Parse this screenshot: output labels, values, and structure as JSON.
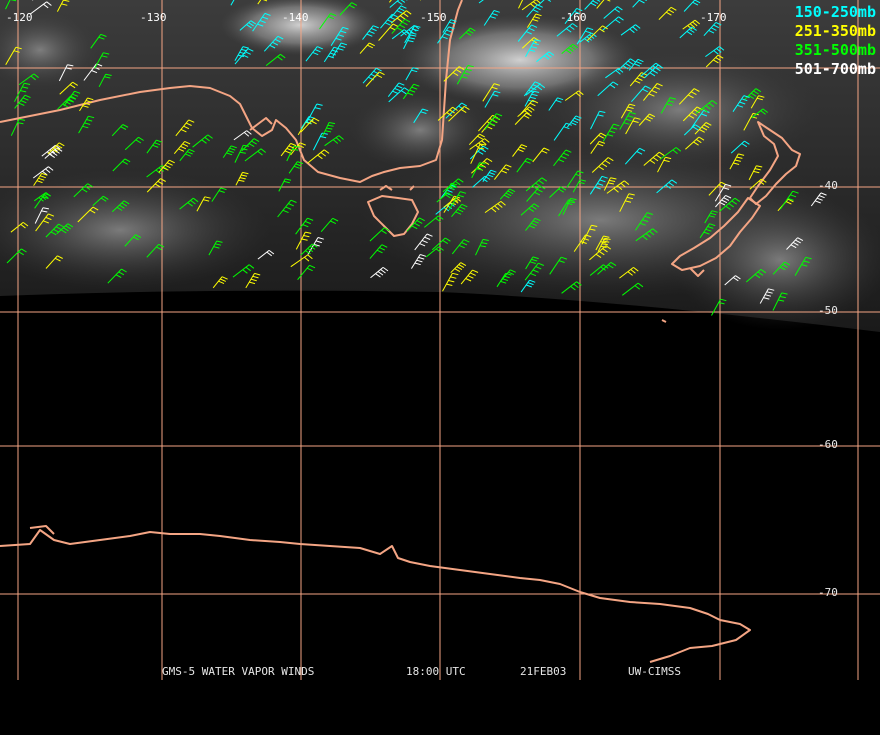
{
  "longitude_labels": [
    "-120",
    "-130",
    "-140",
    "-150",
    "-160",
    "-170"
  ],
  "latitude_labels": [
    "-40",
    "-50",
    "-60",
    "-70"
  ],
  "legend": [
    {
      "label": "150-250mb",
      "color": "#00ffff"
    },
    {
      "label": "251-350mb",
      "color": "#ffff00"
    },
    {
      "label": "351-500mb",
      "color": "#00ff00"
    },
    {
      "label": "501-700mb",
      "color": "#ffffff"
    }
  ],
  "footer": {
    "product": "GMS-5 WATER VAPOR WINDS",
    "time": "18:00 UTC",
    "date": "21FEB03",
    "credit": "UW-CIMSS"
  },
  "colors": {
    "coastline": "#f4a584",
    "gridline": "#f4a584",
    "background": "#000000"
  },
  "map_layers": [
    "water-vapor-imagery",
    "coastline",
    "lat-lon-grid",
    "wind-barbs"
  ]
}
